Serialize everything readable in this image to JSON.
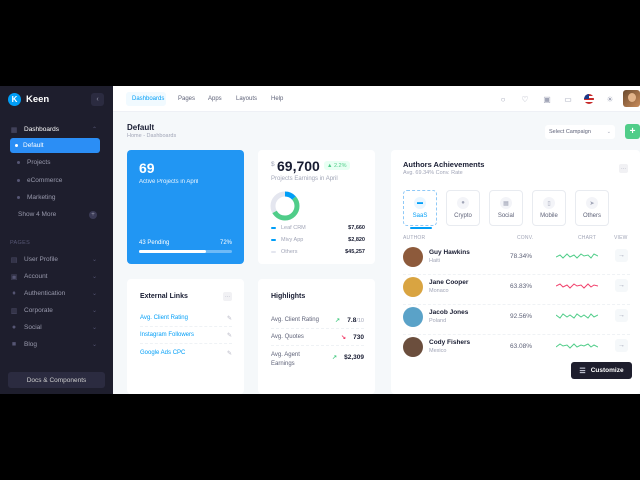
{
  "sidebar": {
    "brand": "Keen",
    "logo_letter": "K",
    "collapse_icon": "‹",
    "items": [
      {
        "label": "Dashboards",
        "icon": "grid-icon"
      },
      {
        "label": "Default"
      },
      {
        "label": "Projects"
      },
      {
        "label": "eCommerce"
      },
      {
        "label": "Marketing"
      },
      {
        "label": "Show 4 More"
      }
    ],
    "section_label": "PAGES",
    "pages": [
      {
        "label": "User Profile",
        "icon": "user-icon"
      },
      {
        "label": "Account",
        "icon": "account-icon"
      },
      {
        "label": "Authentication",
        "icon": "key-icon"
      },
      {
        "label": "Corporate",
        "icon": "building-icon"
      },
      {
        "label": "Social",
        "icon": "social-icon"
      },
      {
        "label": "Blog",
        "icon": "blog-icon"
      }
    ],
    "docs_label": "Docs & Components"
  },
  "header": {
    "nav": [
      "Dashboards",
      "Pages",
      "Apps",
      "Layouts",
      "Help"
    ],
    "active_nav": "Dashboards",
    "icons": [
      "search-icon",
      "activity-icon",
      "apps-icon",
      "notifications-icon",
      "language-flag-icon",
      "theme-sun-icon",
      "user-avatar"
    ]
  },
  "toolbar": {
    "title": "Default",
    "breadcrumb": "Home  -  Dashboards",
    "campaign_select": "Select Campaign",
    "add_label": "+"
  },
  "projects_card": {
    "count": "69",
    "subtitle": "Active Projects in April",
    "pending": "43 Pending",
    "percent_label": "72%",
    "progress": 0.72,
    "color": "#2196f3"
  },
  "earnings_card": {
    "currency": "$",
    "amount": "69,700",
    "change": "▲ 2.2%",
    "subtitle": "Projects Earnings in April",
    "legend": [
      {
        "label": "Leaf CRM",
        "value": "$7,660",
        "color": "#009ef7"
      },
      {
        "label": "Mivy App",
        "value": "$2,820",
        "color": "#50cd89"
      },
      {
        "label": "Others",
        "value": "$45,257",
        "color": "#e4e6ef"
      }
    ]
  },
  "external_links": {
    "title": "External Links",
    "links": [
      "Avg. Client Rating",
      "Instagram Followers",
      "Google Ads CPC"
    ]
  },
  "highlights": {
    "title": "Highlights",
    "rows": [
      {
        "label": "Avg. Client Rating",
        "value": "7.8",
        "suffix": "/10",
        "arrow": "↗",
        "arrow_color": "#50cd89"
      },
      {
        "label": "Avg. Quotes",
        "value": "730",
        "suffix": "",
        "arrow": "↘",
        "arrow_color": "#f1416c"
      },
      {
        "label": "Avg. Agent Earnings",
        "value": "$2,309",
        "suffix": "",
        "arrow": "↗",
        "arrow_color": "#50cd89"
      }
    ]
  },
  "authors": {
    "title": "Authors Achievements",
    "subtitle": "Avg. 69.34% Conv. Rate",
    "tabs": [
      "SaaS",
      "Crypto",
      "Social",
      "Mobile",
      "Others"
    ],
    "active_tab": "SaaS",
    "columns": [
      "AUTHOR",
      "CONV.",
      "CHART",
      "VIEW"
    ],
    "rows": [
      {
        "name": "Guy Hawkins",
        "country": "Haiti",
        "conv": "78.34%",
        "trend_color": "#50cd89",
        "avatar_color": "#8d5a3b"
      },
      {
        "name": "Jane Cooper",
        "country": "Monaco",
        "conv": "63.83%",
        "trend_color": "#f1416c",
        "avatar_color": "#d9a441"
      },
      {
        "name": "Jacob Jones",
        "country": "Poland",
        "conv": "92.56%",
        "trend_color": "#50cd89",
        "avatar_color": "#5aa2c8"
      },
      {
        "name": "Cody Fishers",
        "country": "Mexico",
        "conv": "63.08%",
        "trend_color": "#50cd89",
        "avatar_color": "#6b4e3d"
      }
    ]
  },
  "customize_label": "Customize"
}
